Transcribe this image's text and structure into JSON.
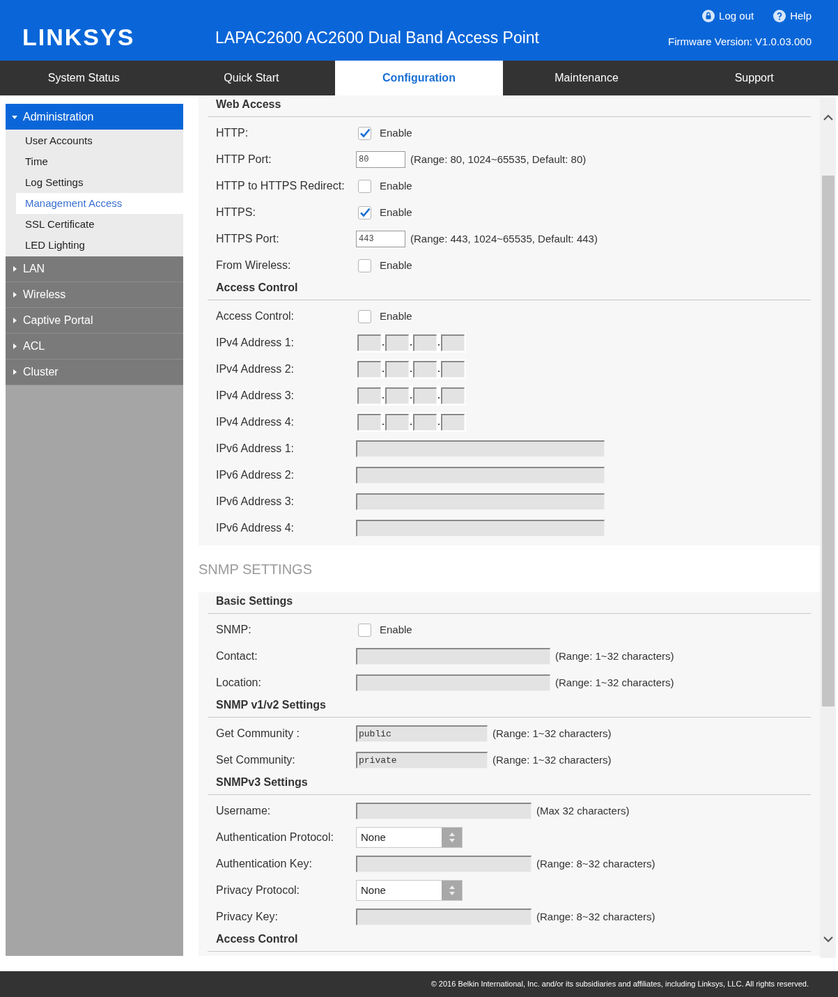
{
  "header": {
    "brand": "LINKSYS",
    "title": "LAPAC2600 AC2600 Dual Band Access Point",
    "links": [
      {
        "kind": "lock",
        "label": "Log out"
      },
      {
        "kind": "help",
        "label": "Help"
      }
    ],
    "firmware": "Firmware Version: V1.0.03.000"
  },
  "tabs": [
    {
      "label": "System Status",
      "selected": false
    },
    {
      "label": "Quick Start",
      "selected": false
    },
    {
      "label": "Configuration",
      "selected": true
    },
    {
      "label": "Maintenance",
      "selected": false
    },
    {
      "label": "Support",
      "selected": false
    }
  ],
  "sidebar": [
    {
      "label": "Administration",
      "expanded": true,
      "children": [
        {
          "label": "User Accounts",
          "selected": false
        },
        {
          "label": "Time",
          "selected": false
        },
        {
          "label": "Log Settings",
          "selected": false
        },
        {
          "label": "Management Access",
          "selected": true
        },
        {
          "label": "SSL Certificate",
          "selected": false
        },
        {
          "label": "LED Lighting",
          "selected": false
        }
      ]
    },
    {
      "label": "LAN",
      "expanded": false
    },
    {
      "label": "Wireless",
      "expanded": false
    },
    {
      "label": "Captive Portal",
      "expanded": false
    },
    {
      "label": "ACL",
      "expanded": false
    },
    {
      "label": "Cluster",
      "expanded": false
    }
  ],
  "management_panel": {
    "groups": [
      {
        "title": "Web Access",
        "rows": [
          {
            "kind": "checkbox",
            "label": "HTTP:",
            "checked": true,
            "text": "Enable"
          },
          {
            "kind": "port",
            "label": "HTTP Port:",
            "value": "80",
            "hint": "(Range: 80, 1024~65535, Default: 80)"
          },
          {
            "kind": "checkbox",
            "label": "HTTP to HTTPS Redirect:",
            "checked": false,
            "text": "Enable"
          },
          {
            "kind": "checkbox",
            "label": "HTTPS:",
            "checked": true,
            "text": "Enable"
          },
          {
            "kind": "port",
            "label": "HTTPS Port:",
            "value": "443",
            "hint": "(Range: 443, 1024~65535, Default: 443)"
          },
          {
            "kind": "checkbox",
            "label": "From Wireless:",
            "checked": false,
            "text": "Enable"
          }
        ]
      },
      {
        "title": "Access Control",
        "rows": [
          {
            "kind": "checkbox",
            "label": "Access Control:",
            "checked": false,
            "text": "Enable"
          },
          {
            "kind": "ipv4",
            "label": "IPv4 Address 1:"
          },
          {
            "kind": "ipv4",
            "label": "IPv4 Address 2:"
          },
          {
            "kind": "ipv4",
            "label": "IPv4 Address 3:"
          },
          {
            "kind": "ipv4",
            "label": "IPv4 Address 4:"
          },
          {
            "kind": "ipv6",
            "label": "IPv6 Address 1:"
          },
          {
            "kind": "ipv6",
            "label": "IPv6 Address 2:"
          },
          {
            "kind": "ipv6",
            "label": "IPv6 Address 3:"
          },
          {
            "kind": "ipv6",
            "label": "IPv6 Address 4:"
          }
        ]
      }
    ]
  },
  "snmp": {
    "title": "SNMP SETTINGS",
    "groups": [
      {
        "title": "Basic Settings",
        "rows": [
          {
            "kind": "checkbox",
            "label": "SNMP:",
            "checked": false,
            "text": "Enable"
          },
          {
            "kind": "wide",
            "label": "Contact:",
            "hint": "(Range: 1~32 characters)"
          },
          {
            "kind": "wide",
            "label": "Location:",
            "hint": "(Range: 1~32 characters)"
          }
        ]
      },
      {
        "title": "SNMP v1/v2 Settings",
        "rows": [
          {
            "kind": "community",
            "label": "Get Community :",
            "value": "public",
            "hint": "(Range: 1~32 characters)"
          },
          {
            "kind": "community",
            "label": "Set Community:",
            "value": "private",
            "hint": "(Range: 1~32 characters)"
          }
        ]
      },
      {
        "title": "SNMPv3 Settings",
        "rows": [
          {
            "kind": "key",
            "label": "Username:",
            "hint": "(Max 32 characters)"
          },
          {
            "kind": "select",
            "label": "Authentication Protocol:",
            "value": "None"
          },
          {
            "kind": "key",
            "label": "Authentication Key:",
            "hint": "(Range: 8~32 characters)"
          },
          {
            "kind": "select",
            "label": "Privacy Protocol:",
            "value": "None"
          },
          {
            "kind": "key",
            "label": "Privacy Key:",
            "hint": "(Range: 8~32 characters)"
          }
        ]
      },
      {
        "title": "Access Control"
      }
    ]
  },
  "footer": "© 2016 Belkin International, Inc. and/or its subsidiaries and affiliates, including Linksys, LLC. All rights reserved."
}
